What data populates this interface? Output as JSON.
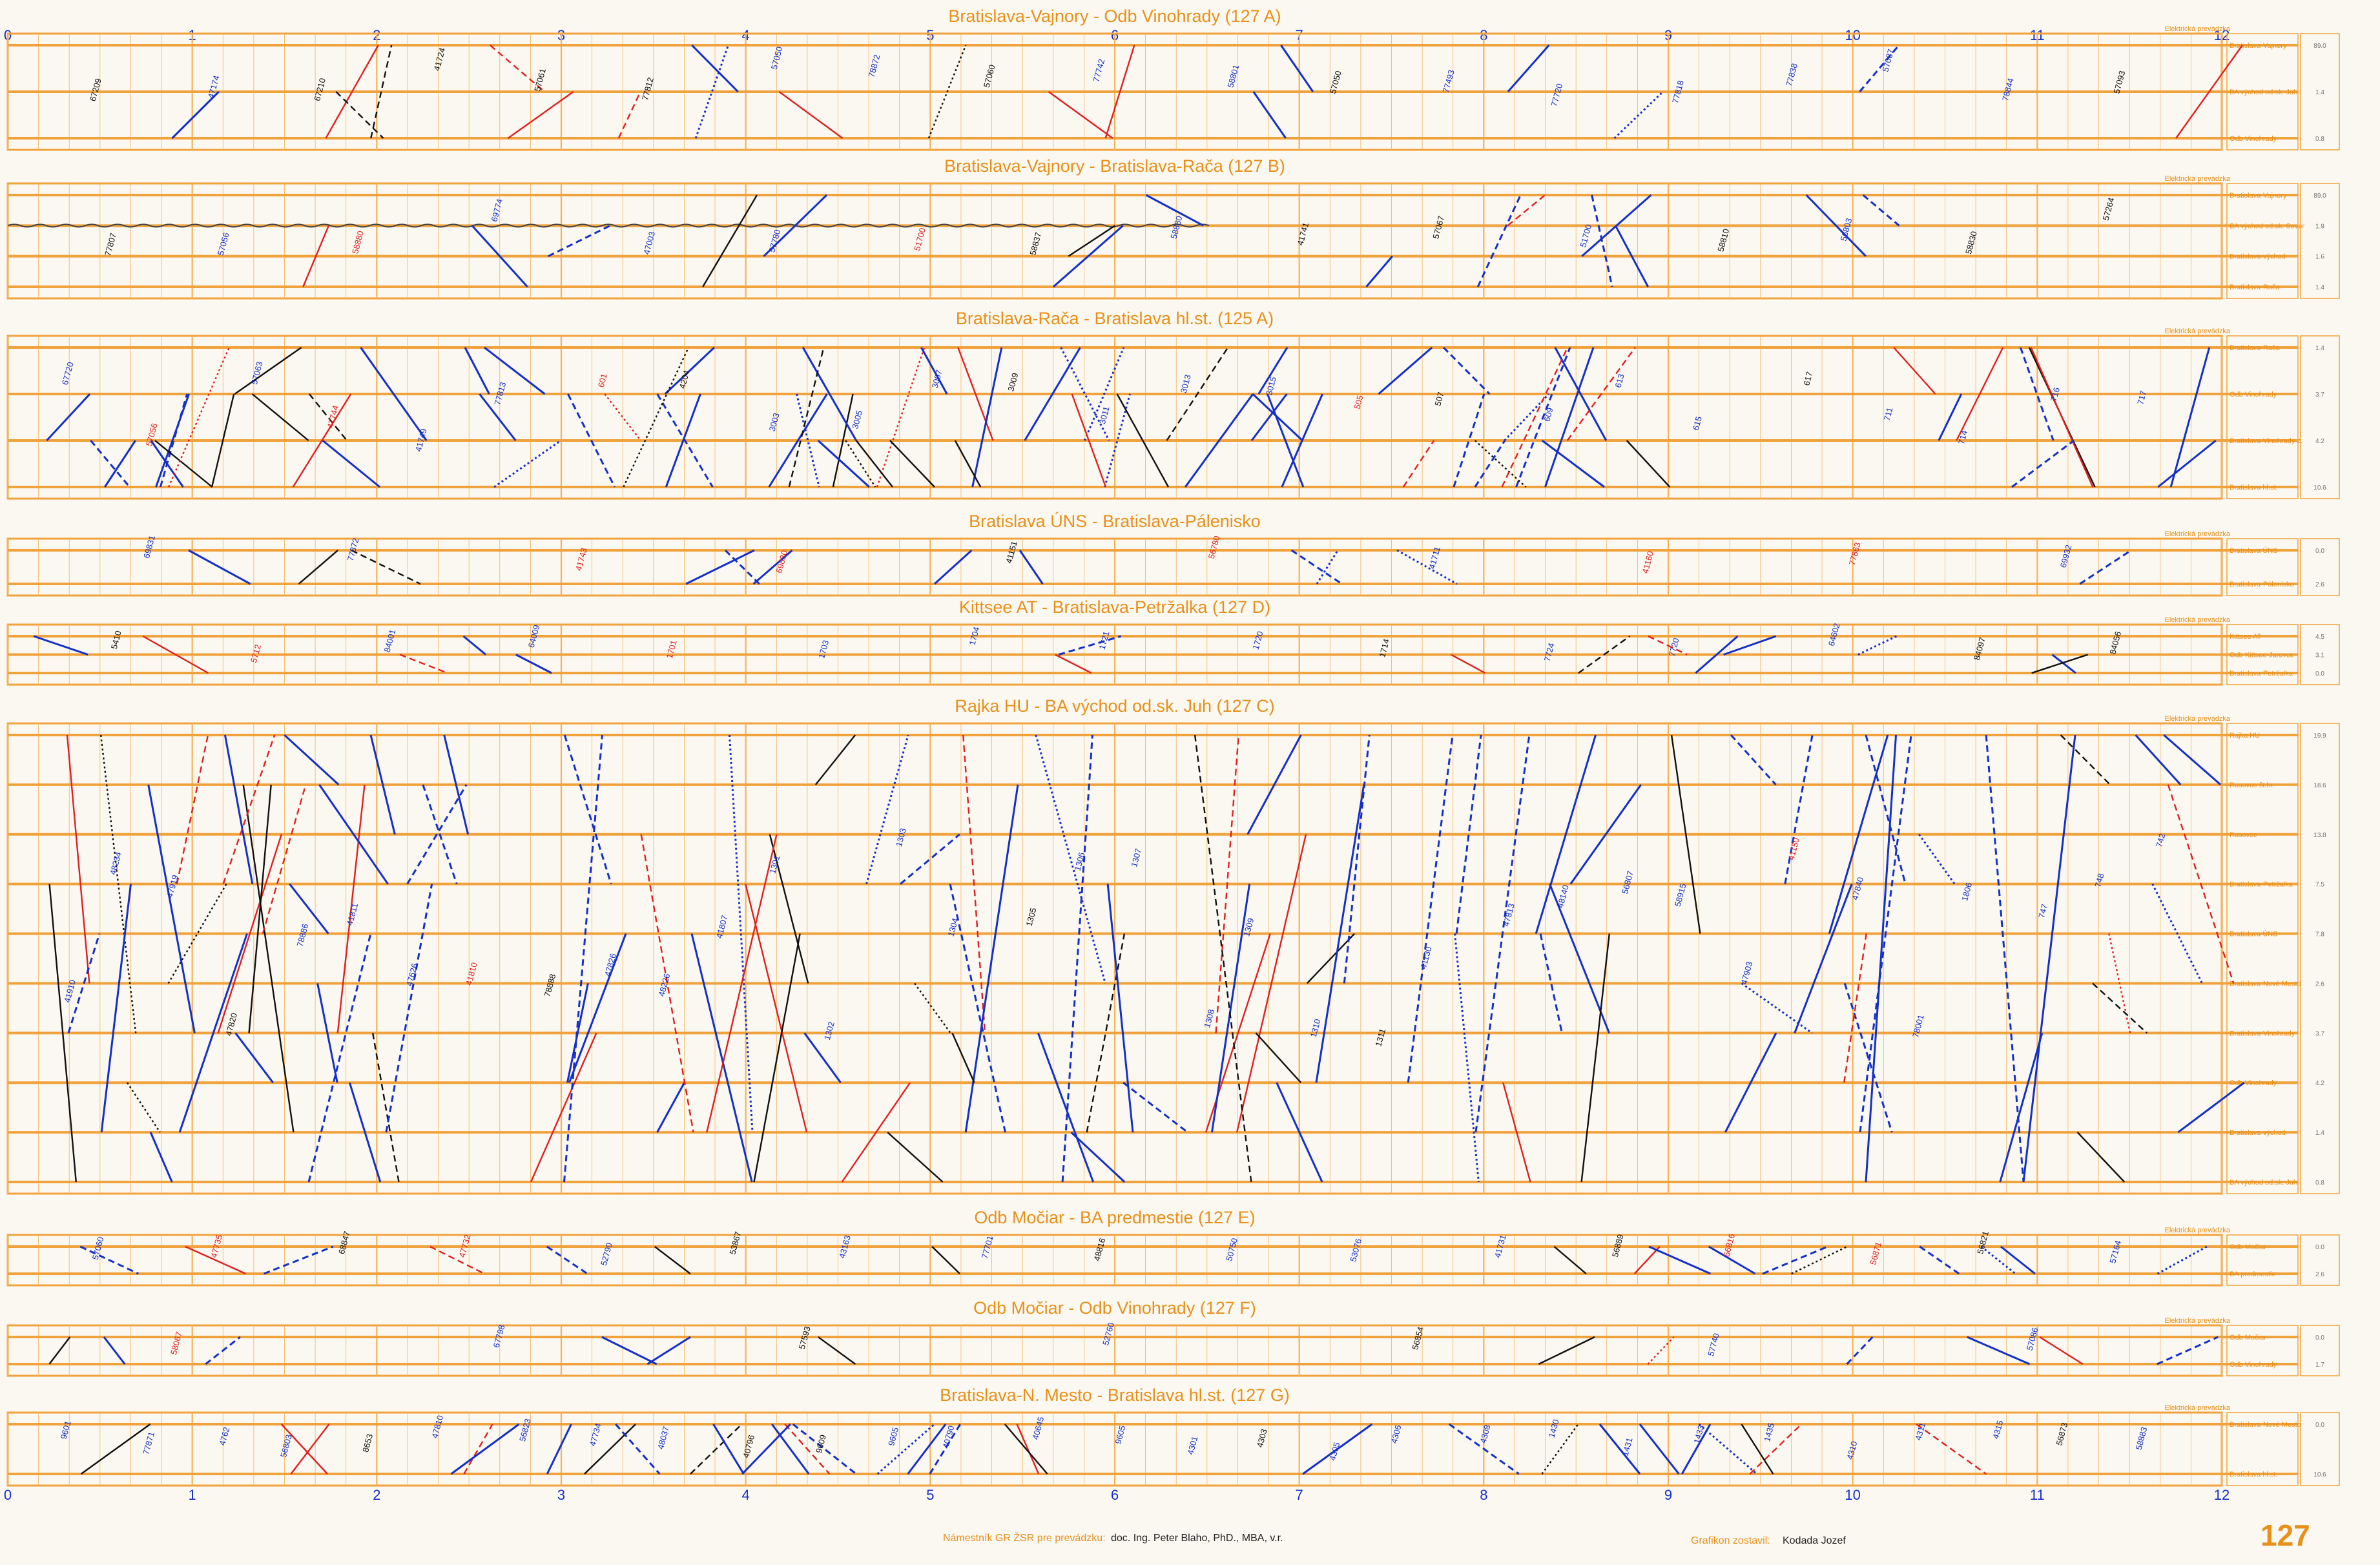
{
  "colors": {
    "frame": "#f0a23c",
    "grid": "#f3b35a",
    "title": "#e8901a",
    "train_blue": "#1530c8",
    "train_red": "#e02020",
    "train_black": "#111111",
    "background": "#fbf8f1"
  },
  "hours": [
    "0",
    "1",
    "2",
    "3",
    "4",
    "5",
    "6",
    "7",
    "8",
    "9",
    "10",
    "11",
    "12"
  ],
  "electric_label": "Elektrická prevádzka",
  "panels": [
    {
      "title": "Bratislava-Vajnory - Odb Vinohrady (127 A)",
      "stations": [
        "Bratislava-Vajnory",
        "BA východ od.sk. Juh",
        "Odb Vinohrady"
      ],
      "km": [
        "89.0",
        "1.4",
        "0.8"
      ],
      "trains": [
        "67209",
        "47174",
        "67210",
        "41724",
        "57061",
        "77812",
        "57050",
        "78872",
        "57060",
        "77742",
        "58801",
        "57050",
        "77493",
        "77720",
        "77818",
        "77838",
        "57087",
        "78844",
        "57093"
      ]
    },
    {
      "title": "Bratislava-Vajnory - Bratislava-Rača (127 B)",
      "stations": [
        "Bratislava-Vajnory",
        "BA východ od.sk. Sever",
        "Bratislava-východ",
        "Bratislava-Rača"
      ],
      "km": [
        "89.0",
        "1.9",
        "1.6",
        "1.4"
      ],
      "trains": [
        "77807",
        "57056",
        "58880",
        "69774",
        "47003",
        "57780",
        "51700",
        "58837",
        "58880",
        "41741",
        "57067",
        "51700",
        "58810",
        "56803",
        "58830",
        "57264"
      ]
    },
    {
      "title": "Bratislava-Rača - Bratislava hl.st. (125 A)",
      "stations": [
        "Bratislava-Rača",
        "Odb Vinohrady",
        "Bratislava-Vinohrady z.",
        "Bratislava hl.st."
      ],
      "km": [
        "1.4",
        "3.7",
        "4.2",
        "10.6"
      ],
      "trains": [
        "67720",
        "57056",
        "57063",
        "47744",
        "41749",
        "77813",
        "601",
        "4204",
        "3003",
        "3005",
        "3007",
        "3009",
        "3011",
        "3013",
        "3015",
        "505",
        "507",
        "609",
        "613",
        "615",
        "617",
        "711",
        "714",
        "716",
        "717"
      ]
    },
    {
      "title": "Bratislava ÚNS - Bratislava-Pálenisko",
      "stations": [
        "Bratislava ÚNS",
        "Bratislava-Pálenisko"
      ],
      "km": [
        "0.0",
        "2.6"
      ],
      "trains": [
        "69831",
        "77872",
        "41743",
        "69830",
        "41151",
        "56780",
        "41711",
        "41160",
        "77863",
        "69932"
      ]
    },
    {
      "title": "Kittsee AT - Bratislava-Petržalka (127 D)",
      "stations": [
        "Kittsee AT",
        "Odb Kittsee-Jarovce",
        "Bratislava-Petržalka"
      ],
      "km": [
        "4.5",
        "3.1",
        "0.0"
      ],
      "trains": [
        "5410",
        "5712",
        "84001",
        "64009",
        "1701",
        "1703",
        "1704",
        "1721",
        "1720",
        "1714",
        "7724",
        "7720",
        "64602",
        "84097",
        "84056"
      ]
    },
    {
      "title": "Rajka HU - BA východ od.sk. Juh (127 C)",
      "stations": [
        "Rajka HU",
        "Rusovce št.hr.",
        "Rusovce",
        "Bratislava-Petržalka",
        "Bratislava ÚNS",
        "Bratislava-Nové Mesto",
        "Bratislava-Vinohrady",
        "Odb Vinohrady",
        "Bratislava-východ",
        "BA východ od.sk. Juh"
      ],
      "km": [
        "19.9",
        "18.6",
        "13.8",
        "7.5",
        "7.8",
        "2.6",
        "3.7",
        "4.2",
        "1.4",
        "0.8"
      ],
      "trains": [
        "41910",
        "48234",
        "47919",
        "47820",
        "78886",
        "41811",
        "47626",
        "41810",
        "78888",
        "47826",
        "48226",
        "41807",
        "1301",
        "1302",
        "1303",
        "1304",
        "1305",
        "1306",
        "1307",
        "1308",
        "1309",
        "1310",
        "1311",
        "41130",
        "47813",
        "48140",
        "56807",
        "58915",
        "47903",
        "41150",
        "47840",
        "78001",
        "1806",
        "747",
        "748",
        "742"
      ]
    },
    {
      "title": "Odb Močiar - BA predmestie (127 E)",
      "stations": [
        "Odb Močiar",
        "BA predmestie"
      ],
      "km": [
        "0.0",
        "2.6"
      ],
      "trains": [
        "57060",
        "47735",
        "68847",
        "47732",
        "52790",
        "53867",
        "43163",
        "77701",
        "48816",
        "50750",
        "53076",
        "41731",
        "56889",
        "56816",
        "56871",
        "56821",
        "57164"
      ]
    },
    {
      "title": "Odb Močiar - Odb Vinohrady (127 F)",
      "stations": [
        "Odb Močiar",
        "Odb Vinohrady"
      ],
      "km": [
        "0.0",
        "1.7"
      ],
      "trains": [
        "58067",
        "67798",
        "57593",
        "52760",
        "56854",
        "57740",
        "57086"
      ]
    },
    {
      "title": "Bratislava-N. Mesto - Bratislava hl.st. (127 G)",
      "stations": [
        "Bratislava-Nové Mesto",
        "Bratislava hl.st."
      ],
      "km": [
        "0.0",
        "10.6"
      ],
      "trains": [
        "9601",
        "77871",
        "4762",
        "56803",
        "8653",
        "47810",
        "56823",
        "47734",
        "48037",
        "40796",
        "9609",
        "9605",
        "40790",
        "40645",
        "9605",
        "4301",
        "4303",
        "4305",
        "4306",
        "4308",
        "1430",
        "1431",
        "1433",
        "1435",
        "4310",
        "4311",
        "4315",
        "56873",
        "58883"
      ]
    }
  ],
  "footer": {
    "signature_label": "Námestník GR ŽSR pre prevádzku:",
    "signature_name": "doc. Ing. Peter Blaho, PhD., MBA, v.r.",
    "author_label": "Grafikon zostavil:",
    "author_name": "Kodada Jozef",
    "sheet_number": "127"
  }
}
